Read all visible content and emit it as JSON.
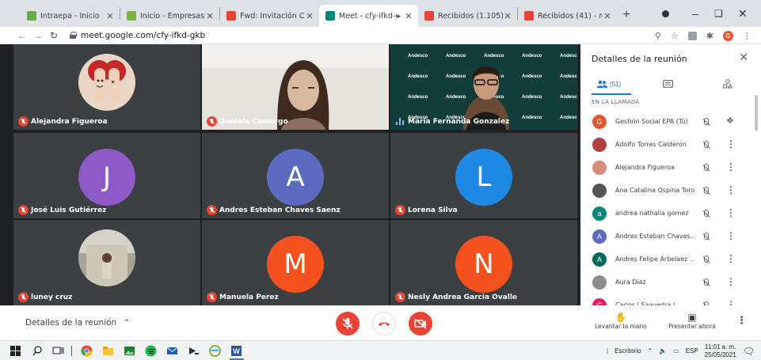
{
  "browser": {
    "tabs": [
      {
        "title": "Intraepa - Inicio",
        "icon": "intraepa-icon",
        "color": "#6aa84f"
      },
      {
        "title": "Inicio - Empresas Públi",
        "icon": "epm-icon",
        "color": "#7cb342"
      },
      {
        "title": "Fwd: Invitación Cámar",
        "icon": "gmail-icon",
        "color": "#ea4335"
      },
      {
        "title": "Meet - cfy-ifkd-gl",
        "icon": "meet-icon",
        "color": "#00897b",
        "active": true
      },
      {
        "title": "Recibidos (1.105) - cm",
        "icon": "gmail-icon",
        "color": "#ea4335"
      },
      {
        "title": "Recibidos (41) - respo",
        "icon": "gmail-icon",
        "color": "#ea4335"
      }
    ],
    "url": "meet.google.com/cfy-ifkd-gkb",
    "profile_initial": "G"
  },
  "tiles": [
    {
      "name": "Alejandra Figueroa",
      "kind": "photo",
      "muted": true
    },
    {
      "name": "Daniela Camargo",
      "kind": "video",
      "muted": true
    },
    {
      "name": "María Fernanda Gonzalez",
      "kind": "video",
      "muted": false,
      "speaking": true
    },
    {
      "name": "José Luis Gutiérrez",
      "kind": "letter",
      "letter": "J",
      "color": "#8e5ac8",
      "muted": true
    },
    {
      "name": "Andres Esteban Chaves Saenz",
      "kind": "letter",
      "letter": "A",
      "color": "#5c6bc0",
      "muted": true
    },
    {
      "name": "Lorena Silva",
      "kind": "letter",
      "letter": "L",
      "color": "#1e88e5",
      "muted": true
    },
    {
      "name": "luney cruz",
      "kind": "photo",
      "muted": true
    },
    {
      "name": "Manuela Perez",
      "kind": "letter",
      "letter": "M",
      "color": "#f4511e",
      "muted": true
    },
    {
      "name": "Nesly Andrea Garcia Ovalle",
      "kind": "letter",
      "letter": "N",
      "color": "#f4511e",
      "muted": true
    }
  ],
  "background_brand": "Andesco",
  "panel": {
    "title": "Detalles de la reunión",
    "people_count": "(51)",
    "section_label": "EN LA LLAMADA",
    "participants": [
      {
        "name": "Gestión Social EPA (Tú)",
        "initial": "G",
        "color": "#e8542f",
        "pinned": true
      },
      {
        "name": "Adolfo Torres Calderon",
        "initial": "",
        "color": "#b0413e"
      },
      {
        "name": "Alejandra Figueroa",
        "initial": "",
        "color": "#d98b7a"
      },
      {
        "name": "Ana Catalina Ospina Toro",
        "initial": "",
        "color": "#555555"
      },
      {
        "name": "andrea nathalia gomez",
        "initial": "a",
        "color": "#00897b"
      },
      {
        "name": "Andres Esteban Chaves...",
        "initial": "A",
        "color": "#5c6bc0"
      },
      {
        "name": "Andres Felipe Arbelaez ...",
        "initial": "A",
        "color": "#00695c"
      },
      {
        "name": "Aura Diaz",
        "initial": "",
        "color": "#8d8d8d"
      },
      {
        "name": "Carlos J Saavedra L",
        "initial": "C",
        "color": "#e91e63"
      }
    ]
  },
  "bottom": {
    "details_label": "Detalles de la reunión",
    "raise_hand": "Levantar la mano",
    "present_now": "Presentar ahora"
  },
  "taskbar": {
    "input_label": "Escritorio",
    "language": "ESP",
    "time": "11:01 a. m.",
    "date": "25/05/2021"
  }
}
